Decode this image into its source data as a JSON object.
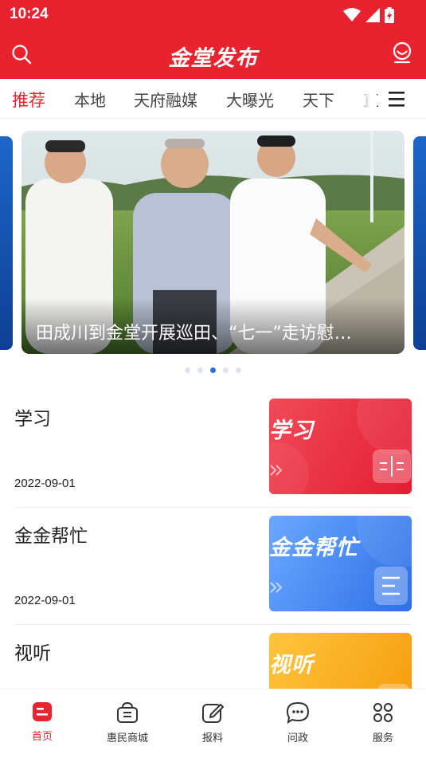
{
  "status_bar": {
    "time": "10:24"
  },
  "header": {
    "title": "金堂发布"
  },
  "tabs": [
    {
      "label": "推荐",
      "active": true
    },
    {
      "label": "本地",
      "active": false
    },
    {
      "label": "天府融媒",
      "active": false
    },
    {
      "label": "大曝光",
      "active": false
    },
    {
      "label": "天下",
      "active": false
    },
    {
      "label": "直",
      "active": false
    }
  ],
  "banner": {
    "caption": "田成川到金堂开展巡田、“七一”走访慰…",
    "pager": {
      "count": 5,
      "active_index": 2
    }
  },
  "news": [
    {
      "title": "学习",
      "date": "2022-09-01",
      "thumb_label": "学习",
      "thumb_icon": "book-icon",
      "thumb_color": "#e8232f"
    },
    {
      "title": "金金帮忙",
      "date": "2022-09-01",
      "thumb_label": "金金帮忙",
      "thumb_icon": "list-icon",
      "thumb_color": "#3b82f6"
    },
    {
      "title": "视听",
      "date": "",
      "thumb_label": "视听",
      "thumb_icon": "play-icon",
      "thumb_color": "#f5a623"
    }
  ],
  "bottom_nav": [
    {
      "label": "首页",
      "icon": "home-icon",
      "active": true
    },
    {
      "label": "惠民商城",
      "icon": "shopping-bag-icon",
      "active": false
    },
    {
      "label": "报料",
      "icon": "edit-icon",
      "active": false
    },
    {
      "label": "问政",
      "icon": "chat-icon",
      "active": false
    },
    {
      "label": "服务",
      "icon": "services-icon",
      "active": false
    }
  ],
  "colors": {
    "brand_red": "#e8232f",
    "pager_active": "#2a6fdb"
  }
}
